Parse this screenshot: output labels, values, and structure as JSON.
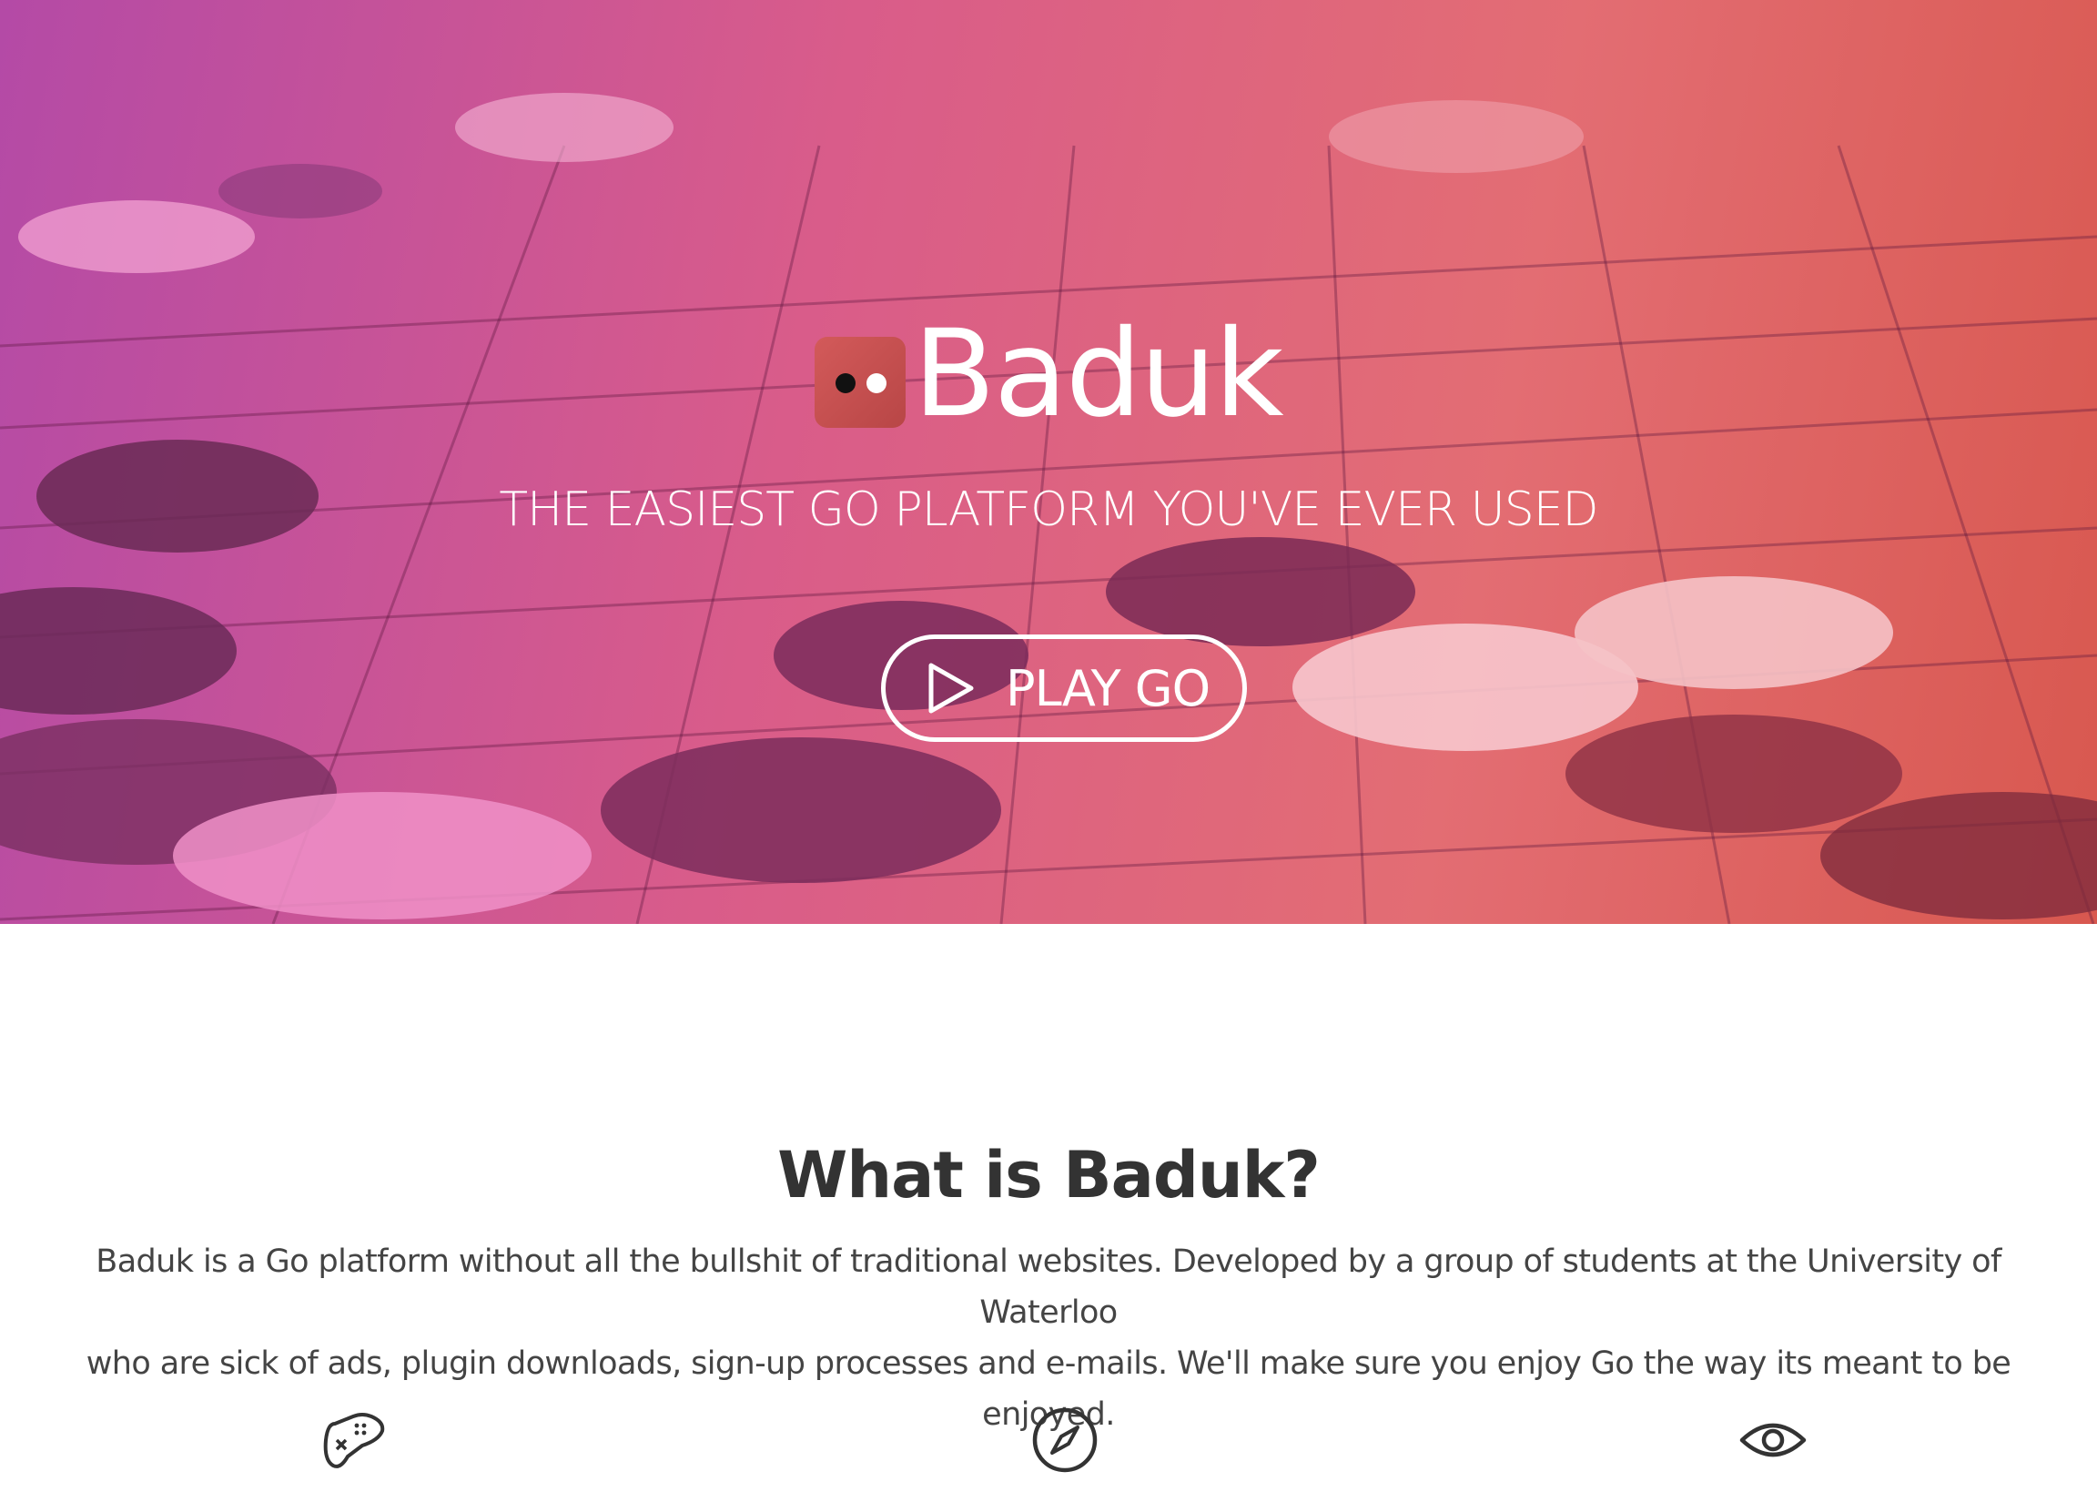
{
  "hero": {
    "brand_name": "Baduk",
    "tagline": "THE EASIEST GO PLATFORM YOU'VE EVER USED",
    "play_button_label": "PLAY GO",
    "play_icon": "play-icon",
    "logo_icon": "baduk-logo-icon"
  },
  "about": {
    "title": "What is Baduk?",
    "line1": "Baduk is a Go platform without all the bullshit of traditional websites. Developed by a group of students at the University of Waterloo",
    "line2": "who are sick of ads, plugin downloads, sign-up processes and e-mails. We'll make sure you enjoy Go the way its meant to be enjoyed."
  },
  "features": {
    "icons": [
      "gamepad-icon",
      "compass-icon",
      "eye-icon"
    ]
  },
  "colors": {
    "hero_gradient": [
      "#b44aa6",
      "#d95c8a",
      "#e36d73",
      "#d8584f"
    ],
    "logo": "#c84f4f",
    "text_dark": "#333333"
  }
}
